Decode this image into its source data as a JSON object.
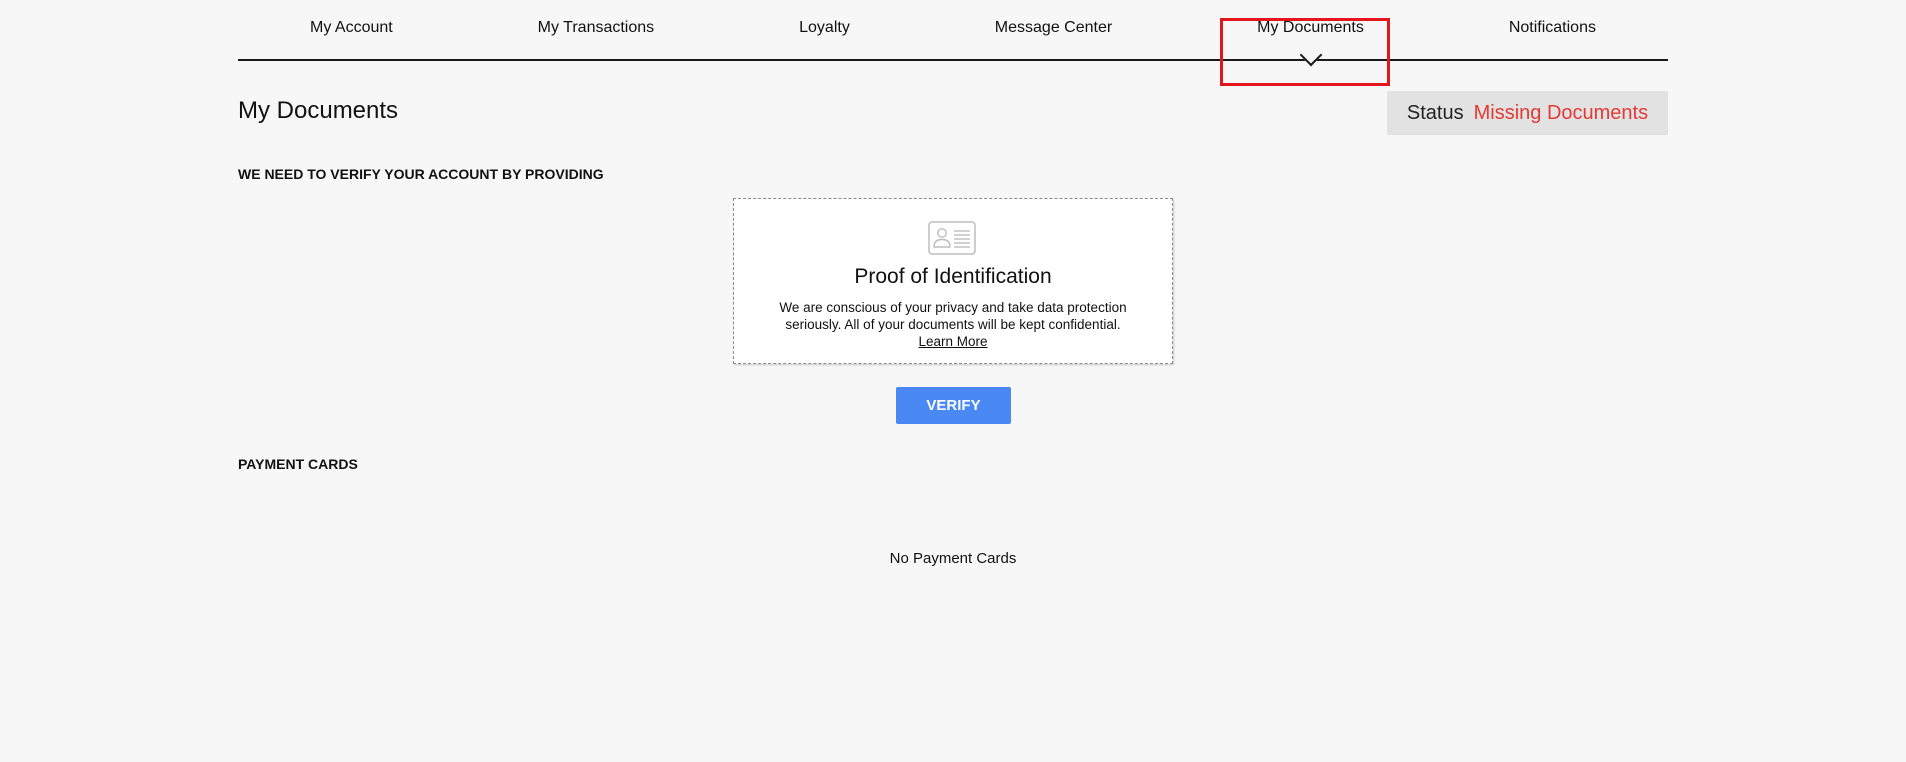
{
  "nav": {
    "items": [
      {
        "label": "My Account"
      },
      {
        "label": "My Transactions"
      },
      {
        "label": "Loyalty"
      },
      {
        "label": "Message Center"
      },
      {
        "label": "My Documents",
        "active": true
      },
      {
        "label": "Notifications"
      }
    ]
  },
  "page": {
    "title": "My Documents"
  },
  "status": {
    "label": "Status",
    "value": "Missing Documents",
    "value_color": "#e53935"
  },
  "verify_section": {
    "heading": "WE NEED TO VERIFY YOUR ACCOUNT BY PROVIDING",
    "card": {
      "icon": "id-card-icon",
      "title": "Proof of Identification",
      "text": "We are conscious of your privacy and take data protection seriously. All of your documents will be kept confidential.",
      "link_label": "Learn More"
    },
    "button_label": "VERIFY",
    "button_color": "#4a89f3"
  },
  "payment_cards": {
    "heading": "PAYMENT CARDS",
    "empty_message": "No Payment Cards"
  },
  "highlight_color": "#e2161d"
}
